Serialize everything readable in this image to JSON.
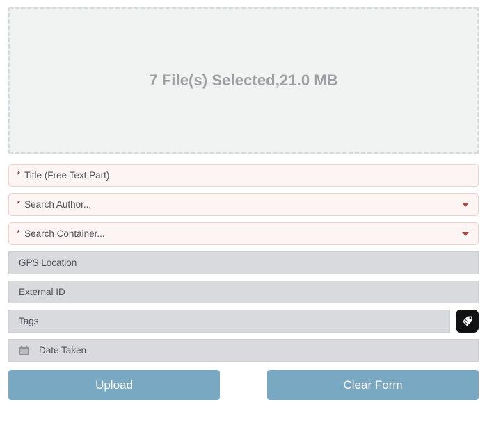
{
  "dropzone": {
    "status_text": "7 File(s) Selected,21.0 MB",
    "file_count": 7,
    "total_size": "21.0 MB",
    "icon": "dropzone-dashed-area"
  },
  "form": {
    "fields": [
      {
        "name": "title",
        "label": "Title (Free Text Part)",
        "placeholder": "Title (Free Text Part)",
        "value": "",
        "required": true,
        "required_marker": "*",
        "type": "text",
        "style": "required"
      },
      {
        "name": "author",
        "label": "Search Author...",
        "placeholder": "Search Author...",
        "value": "",
        "required": true,
        "required_marker": "*",
        "type": "dropdown",
        "style": "required",
        "icon": "chevron-down-icon"
      },
      {
        "name": "container",
        "label": "Search Container...",
        "placeholder": "Search Container...",
        "value": "",
        "required": true,
        "required_marker": "*",
        "type": "dropdown",
        "style": "required",
        "icon": "chevron-down-icon"
      },
      {
        "name": "gps_location",
        "label": "GPS Location",
        "placeholder": "GPS Location",
        "value": "",
        "required": false,
        "type": "text",
        "style": "plain"
      },
      {
        "name": "external_id",
        "label": "External ID",
        "placeholder": "External ID",
        "value": "",
        "required": false,
        "type": "text",
        "style": "plain"
      },
      {
        "name": "tags",
        "label": "Tags",
        "placeholder": "Tags",
        "value": "",
        "required": false,
        "type": "text",
        "style": "plain",
        "action_icon": "tag-icon"
      },
      {
        "name": "date_taken",
        "label": "Date Taken",
        "placeholder": "Date Taken",
        "value": "",
        "required": false,
        "type": "date",
        "style": "plain",
        "icon": "calendar-icon"
      }
    ]
  },
  "actions": {
    "upload_label": "Upload",
    "clear_label": "Clear Form"
  },
  "colors": {
    "button": "#79a8c2",
    "required_field_bg": "#fdf5f4",
    "required_field_border": "#ecd2cf",
    "required_marker": "#8b3a33",
    "plain_field_bg": "#d8dadd",
    "dropzone_bg": "#f1f2f2",
    "dropzone_border": "#d7dadd",
    "dropzone_text": "#9b9fa3",
    "tag_button_bg": "#111214"
  }
}
